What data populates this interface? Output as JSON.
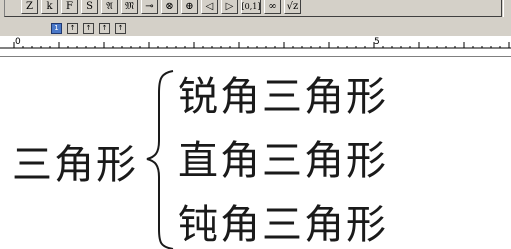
{
  "palette": {
    "symbols": [
      {
        "label": "Z",
        "icon": "double-struck-z-icon"
      },
      {
        "label": "k",
        "icon": "kappa-icon"
      },
      {
        "label": "F",
        "icon": "script-f-icon"
      },
      {
        "label": "S",
        "icon": "script-s-icon"
      },
      {
        "label": "𝔄",
        "icon": "fraktur-a-icon"
      },
      {
        "label": "𝔐",
        "icon": "fraktur-m-icon"
      },
      {
        "label": "⊸",
        "icon": "multimap-icon"
      },
      {
        "label": "⊗",
        "icon": "circled-times-icon"
      },
      {
        "label": "⊕",
        "icon": "circled-plus-icon"
      },
      {
        "label": "◁",
        "icon": "left-triangle-icon"
      },
      {
        "label": "▷",
        "icon": "right-triangle-icon"
      },
      {
        "label": "[0,1]",
        "icon": "interval-icon"
      },
      {
        "label": "∞",
        "icon": "infinity-icon"
      },
      {
        "label": "√z",
        "icon": "sqrt-icon"
      }
    ]
  },
  "tabs": {
    "buttons": [
      {
        "label": "1",
        "icon": "tab-left-icon",
        "active": true
      },
      {
        "label": "↑",
        "icon": "tab-center-icon",
        "active": false
      },
      {
        "label": "↑",
        "icon": "tab-right-icon",
        "active": false
      },
      {
        "label": "↑",
        "icon": "tab-decimal-icon",
        "active": false
      },
      {
        "label": "↑",
        "icon": "tab-bar-icon",
        "active": false
      }
    ]
  },
  "ruler": {
    "mark_start": "0",
    "mark_five": "5"
  },
  "document": {
    "main_term": "三角形",
    "items": [
      "锐角三角形",
      "直角三角形",
      "钝角三角形"
    ]
  }
}
